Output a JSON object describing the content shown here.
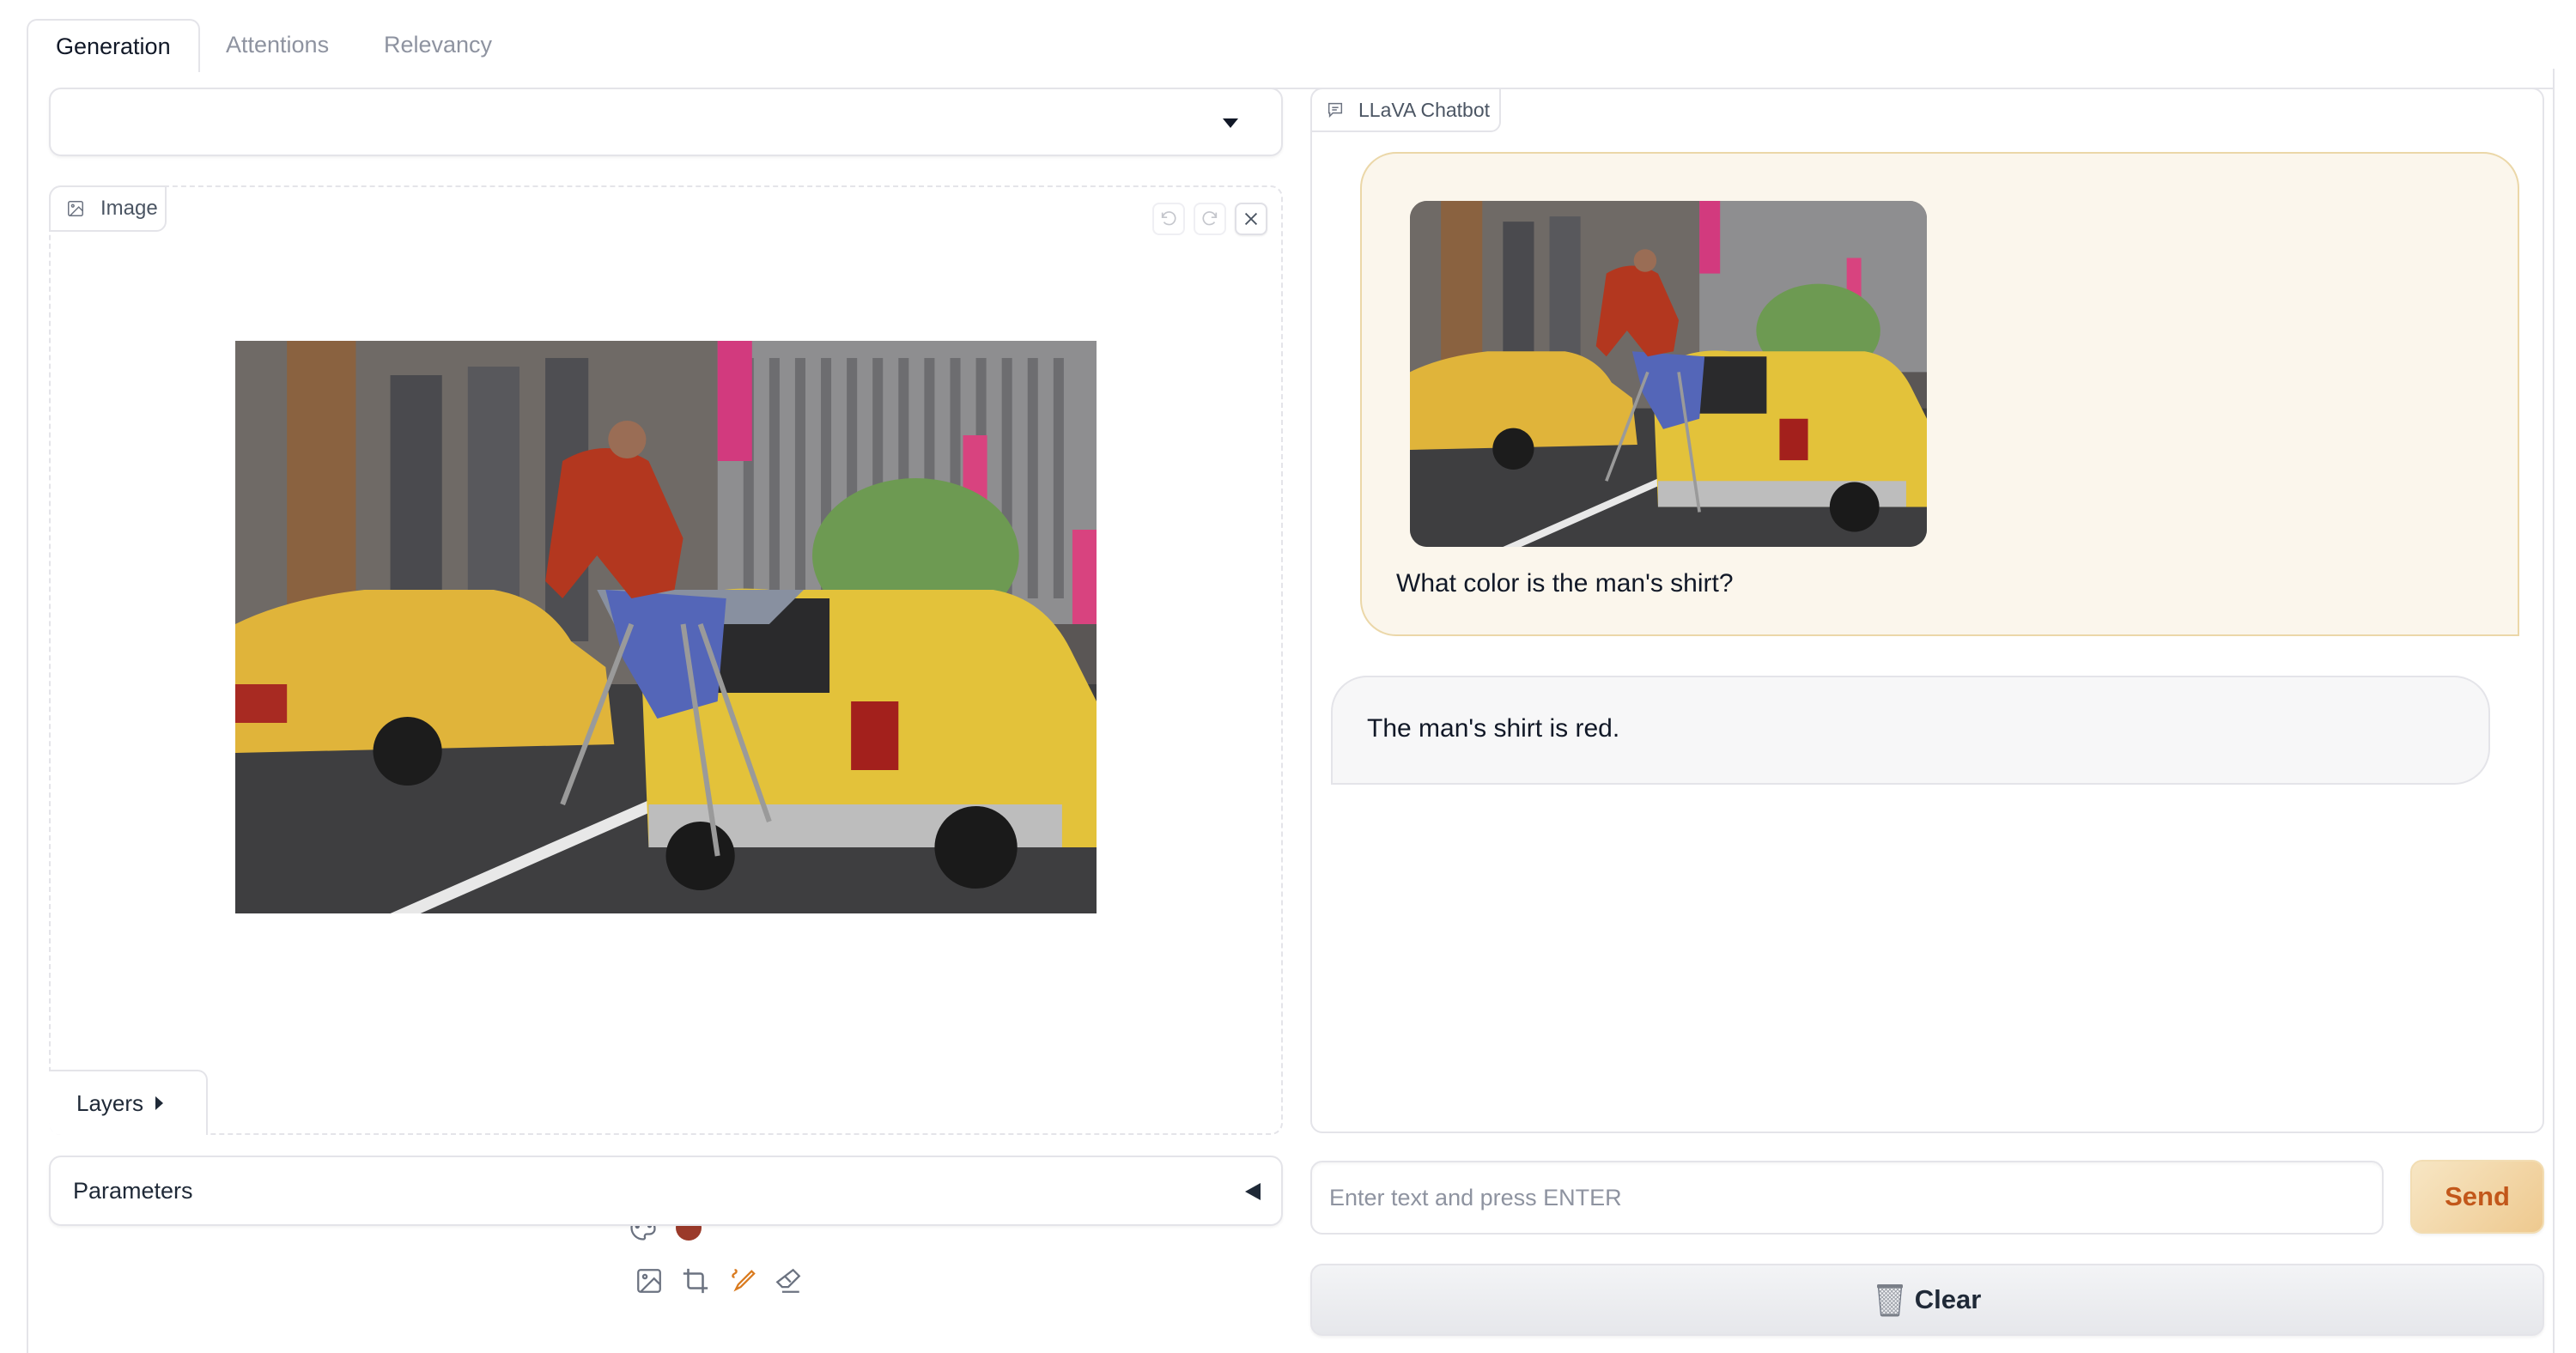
{
  "tabs": [
    {
      "label": "Generation",
      "selected": true
    },
    {
      "label": "Attentions",
      "selected": false
    },
    {
      "label": "Relevancy",
      "selected": false
    }
  ],
  "left": {
    "dropdown": {
      "value": "",
      "icon": "caret-down-icon"
    },
    "image_editor": {
      "label": "Image",
      "label_icon": "image-icon",
      "controls": [
        {
          "name": "undo",
          "icon": "undo-icon",
          "enabled": false
        },
        {
          "name": "redo",
          "icon": "redo-icon",
          "enabled": false
        },
        {
          "name": "clear",
          "icon": "close-icon",
          "enabled": true
        }
      ],
      "image_alt": "Man in red shirt ironing on an ironing board attached to a yellow taxi on a city street",
      "brush_color": "#9b3a2a",
      "tools": [
        {
          "name": "image",
          "icon": "image-icon",
          "active": false
        },
        {
          "name": "crop",
          "icon": "crop-icon",
          "active": false
        },
        {
          "name": "brush",
          "icon": "brush-icon",
          "active": true
        },
        {
          "name": "eraser",
          "icon": "eraser-icon",
          "active": false
        }
      ],
      "layers_label": "Layers"
    },
    "parameters_label": "Parameters"
  },
  "chatbot": {
    "label": "LLaVA Chatbot",
    "label_icon": "chat-icon",
    "messages": [
      {
        "role": "user",
        "has_image": true,
        "text": "What color is the man's shirt?"
      },
      {
        "role": "bot",
        "text": "The man's shirt is red."
      }
    ]
  },
  "input": {
    "placeholder": "Enter text and press ENTER",
    "value": ""
  },
  "buttons": {
    "send": "Send",
    "clear": "Clear",
    "clear_icon": "wastebasket-icon"
  },
  "colors": {
    "accent": "#c2571a",
    "user_bubble_bg": "#fbf6ec",
    "user_bubble_border": "#ebd7a8",
    "bot_bubble_bg": "#f7f7f8",
    "tool_active": "#d97a1e"
  }
}
